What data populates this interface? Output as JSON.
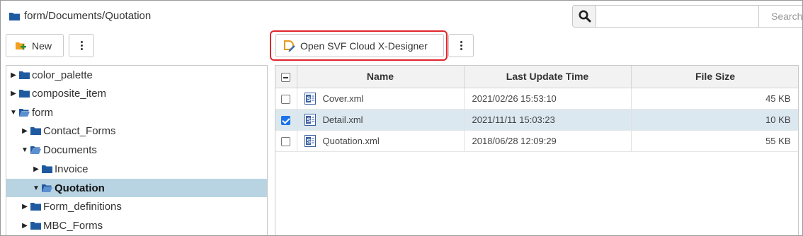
{
  "path": {
    "text": "form/Documents/Quotation"
  },
  "search": {
    "placeholder": "",
    "button_label": "Search"
  },
  "toolbar": {
    "new_label": "New",
    "open_label": "Open SVF Cloud X-Designer"
  },
  "tree": {
    "items": [
      {
        "label": "color_palette",
        "expanded": false,
        "selected": false
      },
      {
        "label": "composite_item",
        "expanded": false,
        "selected": false
      },
      {
        "label": "form",
        "expanded": true,
        "selected": false
      },
      {
        "label": "Contact_Forms",
        "expanded": false,
        "selected": false
      },
      {
        "label": "Documents",
        "expanded": true,
        "selected": false
      },
      {
        "label": "Invoice",
        "expanded": false,
        "selected": false
      },
      {
        "label": "Quotation",
        "expanded": true,
        "selected": true
      },
      {
        "label": "Form_definitions",
        "expanded": false,
        "selected": false
      },
      {
        "label": "MBC_Forms",
        "expanded": false,
        "selected": false
      }
    ]
  },
  "table": {
    "columns": [
      "Name",
      "Last Update Time",
      "File Size"
    ],
    "rows": [
      {
        "name": "Cover.xml",
        "time": "2021/02/26 15:53:10",
        "size": "45 KB",
        "checked": false
      },
      {
        "name": "Detail.xml",
        "time": "2021/11/11 15:03:23",
        "size": "10 KB",
        "checked": true
      },
      {
        "name": "Quotation.xml",
        "time": "2018/06/28 12:09:29",
        "size": "55 KB",
        "checked": false
      }
    ]
  },
  "colors": {
    "highlight": "#e0262c",
    "folder": "#1f5aa0",
    "selected_tree": "#b8d4e3",
    "selected_row": "#dbe8f0",
    "checkbox": "#1a73e8"
  },
  "icons": {
    "path": "folder-icon",
    "search": "search-icon",
    "new": "new-folder-icon",
    "open": "designer-pencil-icon",
    "more": "kebab-menu-icon",
    "file": "xml-file-icon",
    "tree": "folder-icon"
  }
}
